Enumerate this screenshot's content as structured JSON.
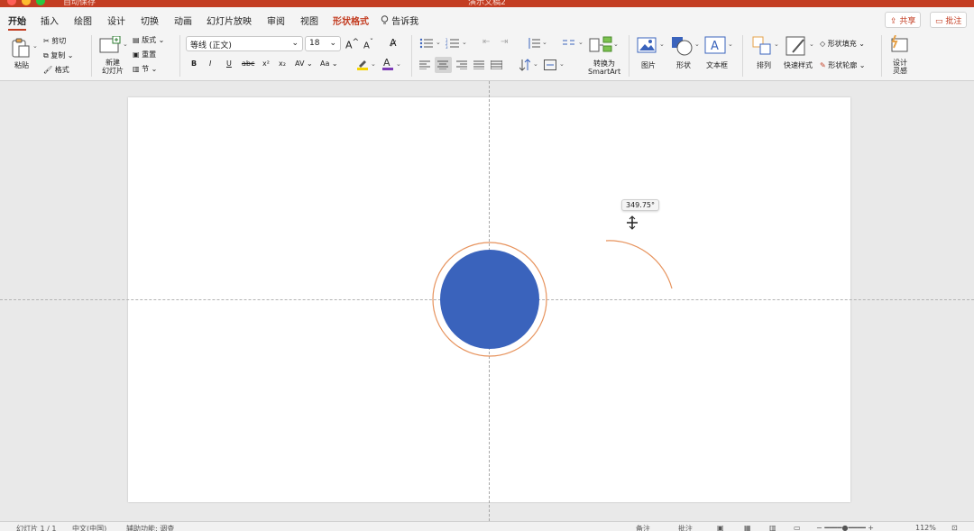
{
  "window": {
    "autosave_label": "自动保存",
    "autosave_state": "关闭",
    "doc_title": "演示文稿2"
  },
  "tabs": [
    {
      "label": "开始"
    },
    {
      "label": "插入"
    },
    {
      "label": "绘图"
    },
    {
      "label": "设计"
    },
    {
      "label": "切换"
    },
    {
      "label": "动画"
    },
    {
      "label": "幻灯片放映"
    },
    {
      "label": "审阅"
    },
    {
      "label": "视图"
    },
    {
      "label": "形状格式"
    },
    {
      "label": "告诉我"
    }
  ],
  "top_buttons": {
    "share": "共享",
    "comments": "批注"
  },
  "ribbon": {
    "clipboard": {
      "paste": "粘贴",
      "cut": "剪切",
      "copy": "复制",
      "format": "格式"
    },
    "slides": {
      "new_slide": "新建\n幻灯片",
      "layout": "版式",
      "reset": "重置",
      "section": "节"
    },
    "font": {
      "name": "等线 (正文)",
      "size": "18",
      "bold": "B",
      "italic": "I",
      "underline": "U",
      "strike": "abc",
      "superscript": "x²",
      "subscript": "x₂",
      "spacing": "AV",
      "case": "Aa"
    },
    "smartart": "转换为\nSmartArt",
    "insert": {
      "picture": "图片",
      "shape": "形状",
      "textbox": "文本框"
    },
    "drawing": {
      "arrange": "排列",
      "quick_styles": "快速样式",
      "shape_fill": "形状填充",
      "shape_outline": "形状轮廓"
    },
    "designer": "设计\n灵感"
  },
  "slide": {
    "angle_tooltip": "349.75°",
    "circle_fill": "#3a63bc",
    "outline_color": "#e7935d"
  },
  "colors": {
    "accent": "#c33d22",
    "highlight": "#f5d400",
    "font_color": "#7c3ab6"
  },
  "statusbar": {
    "slide_info": "幻灯片 1 / 1",
    "language": "中文(中国)",
    "accessibility": "辅助功能: 调查",
    "notes": "备注",
    "comments": "批注",
    "zoom": "112%"
  }
}
